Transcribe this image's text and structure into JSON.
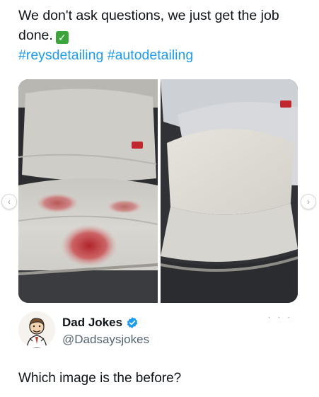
{
  "tweet": {
    "line1": "We don't ask questions, we just get the job",
    "line2": "done.",
    "hashtags": "#reysdetailing #autodetailing",
    "checkmark_icon": "white-check-mark-emoji"
  },
  "carousel": {
    "prev_icon": "chevron-left-icon",
    "next_icon": "chevron-right-icon",
    "prev_glyph": "‹",
    "next_glyph": "›"
  },
  "author": {
    "name": "Dad Jokes",
    "handle": "@Dadsaysjokes",
    "more": "· · ·"
  },
  "quote": {
    "text": "Which image is the before?"
  },
  "colors": {
    "link": "#1d9bf0",
    "verified": "#1d9bf0",
    "check": "#3ba53b"
  }
}
